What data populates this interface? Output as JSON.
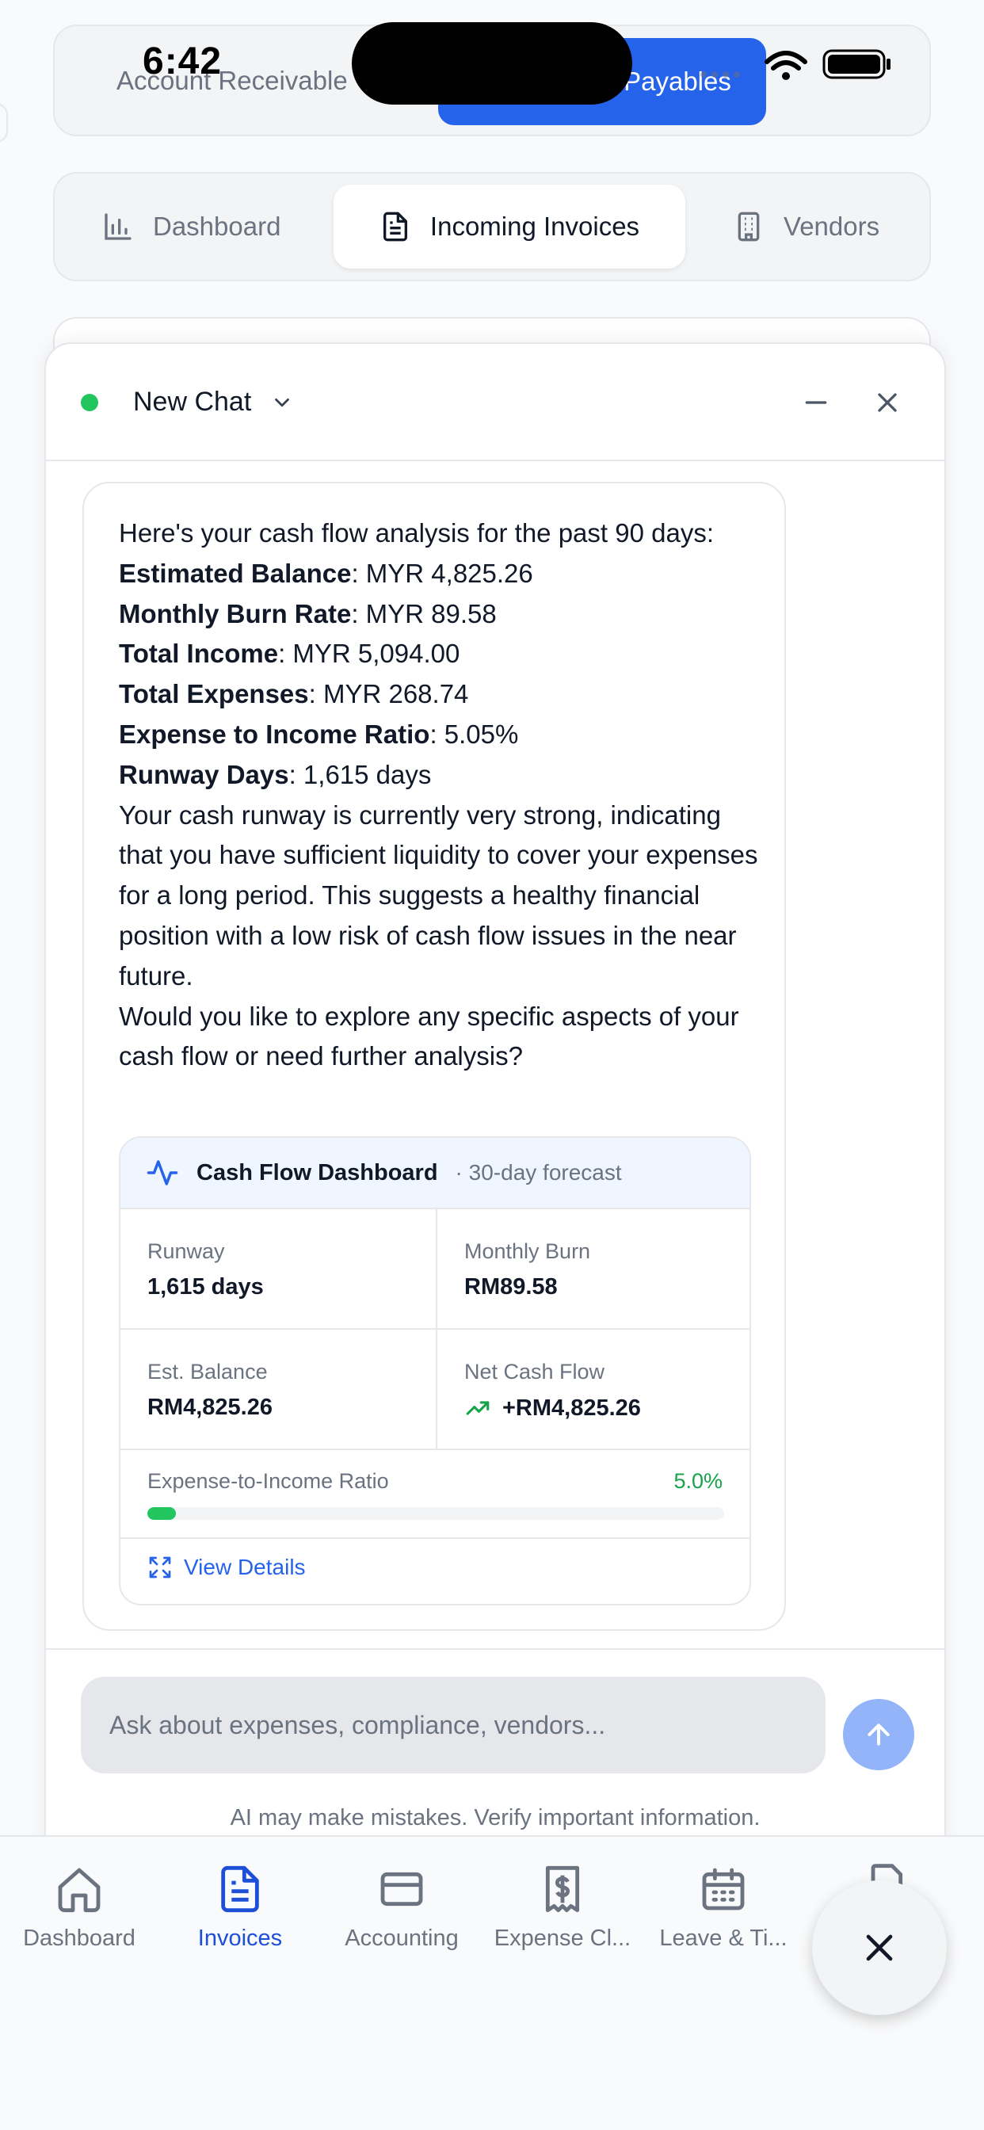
{
  "status_bar": {
    "time": "6:42"
  },
  "top_switch": {
    "left": "Account Receivable",
    "right": "Payables"
  },
  "tabs": [
    {
      "label": "Dashboard",
      "icon": "bar-chart-icon"
    },
    {
      "label": "Incoming Invoices",
      "icon": "document-icon"
    },
    {
      "label": "Vendors",
      "icon": "building-icon"
    }
  ],
  "chat": {
    "title": "New Chat",
    "message": {
      "intro": "Here's your cash flow analysis for the past 90 days:",
      "metrics": [
        {
          "label": "Estimated Balance",
          "value": ": MYR 4,825.26"
        },
        {
          "label": "Monthly Burn Rate",
          "value": ": MYR 89.58"
        },
        {
          "label": "Total Income",
          "value": ": MYR 5,094.00"
        },
        {
          "label": "Total Expenses",
          "value": ": MYR 268.74"
        },
        {
          "label": "Expense to Income Ratio",
          "value": ": 5.05%"
        },
        {
          "label": "Runway Days",
          "value": ": 1,615 days"
        }
      ],
      "body": "Your cash runway is currently very strong, indicating that you have sufficient liquidity to cover your expenses for a long period. This suggests a healthy financial position with a low risk of cash flow issues in the near future.",
      "question": "Would you like to explore any specific aspects of your cash flow or need further analysis?"
    },
    "card": {
      "title": "Cash Flow Dashboard",
      "subtitle": "· 30-day forecast",
      "runway_label": "Runway",
      "runway_value": "1,615 days",
      "burn_label": "Monthly Burn",
      "burn_value": "RM89.58",
      "balance_label": "Est. Balance",
      "balance_value": "RM4,825.26",
      "net_label": "Net Cash Flow",
      "net_value": "+RM4,825.26",
      "ratio_label": "Expense-to-Income Ratio",
      "ratio_value": "5.0%",
      "ratio_fraction": 0.05,
      "details_label": "View Details",
      "accent": "#2563eb",
      "positive": "#16a34a"
    },
    "input_placeholder": "Ask about expenses, compliance, vendors...",
    "disclaimer": "AI may make mistakes. Verify important information."
  },
  "bottom_nav": [
    {
      "label": "Dashboard",
      "icon": "home-icon"
    },
    {
      "label": "Invoices",
      "icon": "invoice-icon"
    },
    {
      "label": "Accounting",
      "icon": "card-icon"
    },
    {
      "label": "Expense Cl...",
      "icon": "receipt-icon"
    },
    {
      "label": "Leave & Ti...",
      "icon": "calendar-icon"
    }
  ]
}
